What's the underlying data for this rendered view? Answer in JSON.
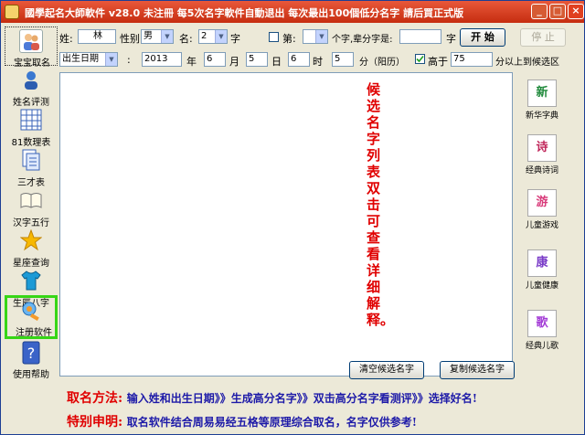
{
  "window": {
    "title": "國學起名大師軟件 v28.0  未注冊  每5次名字軟件自動退出 每次最出100個低分名字 請后買正式版",
    "controls": {
      "minimize": "_",
      "maximize": "□",
      "close": "×"
    }
  },
  "sidebar": {
    "items": [
      {
        "label": "宝宝取名",
        "icon": "people-icon"
      },
      {
        "label": "姓名评测",
        "icon": "person-search-icon"
      },
      {
        "label": "81数理表",
        "icon": "table-icon"
      },
      {
        "label": "三才表",
        "icon": "document-icon"
      },
      {
        "label": "汉字五行",
        "icon": "book-icon"
      },
      {
        "label": "星座查询",
        "icon": "star-icon"
      },
      {
        "label": "生辰八字",
        "icon": "shirt-icon"
      },
      {
        "label": "注册软件",
        "icon": "key-icon"
      },
      {
        "label": "使用帮助",
        "icon": "help-icon"
      }
    ]
  },
  "form": {
    "surname_label": "姓:",
    "surname_value": "林",
    "gender_label": "性别",
    "gender_value": "男",
    "name_label": "名:",
    "name_value": "2",
    "name_unit": "字",
    "fix_label": "第:",
    "fix_hint": "个字,辈分字是:",
    "fix_unit": "字",
    "start_button": "开 始",
    "stop_button": "停 止",
    "date_type": "出生日期",
    "year_value": "2013",
    "year_unit": "年",
    "month_value": "6",
    "month_unit": "月",
    "day_value": "5",
    "day_unit": "日",
    "hour_value": "6",
    "hour_unit": "时",
    "minute_value": "5",
    "minute_unit": "分（阳历）",
    "score_label": "高于",
    "score_value": "75",
    "score_suffix": "分以上到候选区"
  },
  "candidate_area": {
    "hint": "候选名字列表双击可查看详细解释。",
    "clear_button": "清空候选名字",
    "copy_button": "复制候选名字"
  },
  "right_tools": [
    {
      "label": "新华字典",
      "icon": "dictionary-icon",
      "glyph": "新"
    },
    {
      "label": "经典诗词",
      "icon": "poetry-icon",
      "glyph": "诗"
    },
    {
      "label": "儿童游戏",
      "icon": "game-icon",
      "glyph": "游"
    },
    {
      "label": "儿童健康",
      "icon": "health-icon",
      "glyph": "康"
    },
    {
      "label": "经典儿歌",
      "icon": "song-icon",
      "glyph": "歌"
    }
  ],
  "footer": {
    "method_head": "取名方法:",
    "method_body": "输入姓和出生日期》》生成高分名字》》双击高分名字看测评》》选择好名!",
    "notice_head": "特别申明:",
    "notice_body": "取名软件结合周易易经五格等原理综合取名，名字仅供参考!"
  }
}
